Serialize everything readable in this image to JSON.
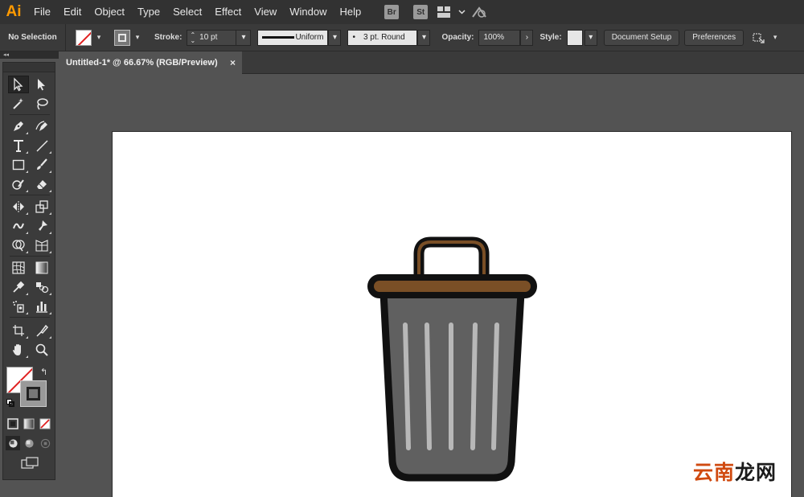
{
  "app": {
    "logo": "Ai"
  },
  "menu": [
    "File",
    "Edit",
    "Object",
    "Type",
    "Select",
    "Effect",
    "View",
    "Window",
    "Help"
  ],
  "bridge_badges": [
    "Br",
    "St"
  ],
  "control": {
    "selection": "No Selection",
    "stroke_label": "Stroke:",
    "stroke_value": "10 pt",
    "profile": "Uniform",
    "brush": "3 pt. Round",
    "opacity_label": "Opacity:",
    "opacity_value": "100%",
    "style_label": "Style:",
    "doc_setup": "Document Setup",
    "preferences": "Preferences"
  },
  "panel": {
    "collapse_glyph": "◂◂"
  },
  "document_tab": {
    "title": "Untitled-1* @ 66.67% (RGB/Preview)",
    "close": "×"
  },
  "artwork": {
    "lid_color": "#7a4f26",
    "body_color": "#606060",
    "stripe_color": "#b8b8b8",
    "outline_color": "#111111"
  },
  "watermark": {
    "part1": "云南",
    "part2": "龙网"
  },
  "colors": {
    "ai_orange": "#ff9a00",
    "menubar": "#323232",
    "canvas": "#535353"
  }
}
